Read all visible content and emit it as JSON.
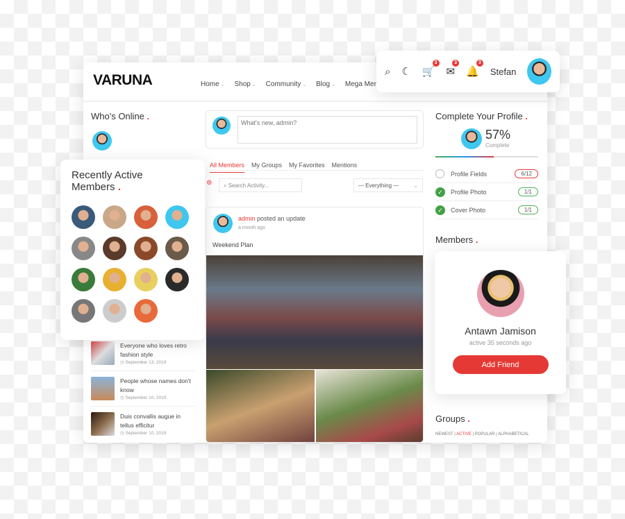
{
  "brand": {
    "logo": "VARUNA"
  },
  "nav": [
    "Home",
    "Shop",
    "Community",
    "Blog",
    "Mega Menu"
  ],
  "header": {
    "user": "Stefan",
    "cart_count": "3",
    "mail_count": "3",
    "notif_count": "3"
  },
  "whos_online": {
    "title": "Who's Online"
  },
  "recently_active": {
    "title_line1": "Recently Active",
    "title_line2": "Members",
    "count": 15
  },
  "posts": [
    {
      "title": "Everyone who loves retro fashion style",
      "date": "September 13, 2019"
    },
    {
      "title": "People whose names don't know",
      "date": "September 10, 2019"
    },
    {
      "title": "Duis convallis augue in tellus efficitur",
      "date": "September 10, 2019"
    }
  ],
  "composer": {
    "placeholder": "What's new, admin?"
  },
  "tabs": [
    "All Members",
    "My Groups",
    "My Favorites",
    "Mentions"
  ],
  "search": {
    "placeholder": "Search Activity..."
  },
  "filter": {
    "selected": "— Everything —"
  },
  "activity": {
    "user": "admin",
    "action": "posted an update",
    "time": "a month ago",
    "text": "Weekend Plan"
  },
  "profile": {
    "title": "Complete Your Profile",
    "percent": "57%",
    "percent_value": 57,
    "complete_label": "Complete",
    "items": [
      {
        "label": "Profile Fields",
        "value": "6/12",
        "done": false
      },
      {
        "label": "Profile Photo",
        "value": "1/1",
        "done": true
      },
      {
        "label": "Cover Photo",
        "value": "1/1",
        "done": true
      }
    ]
  },
  "members": {
    "title": "Members",
    "name": "Antawn Jamison",
    "status": "active 35 seconds ago",
    "button": "Add Friend"
  },
  "groups": {
    "title": "Groups",
    "filters": [
      "NEWEST",
      "ACTIVE",
      "POPULAR",
      "ALPHABETICAL"
    ],
    "active_filter": "ACTIVE"
  },
  "colors": {
    "accent": "#e53935",
    "success": "#43a047"
  }
}
